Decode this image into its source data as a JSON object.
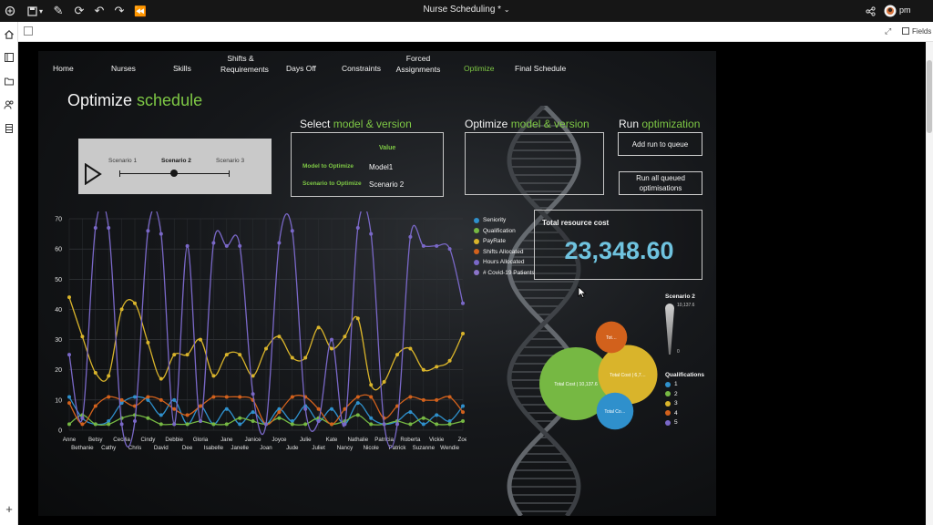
{
  "app": {
    "title": "Nurse Scheduling *",
    "user": "pm",
    "fields_label": "Fields"
  },
  "nav": {
    "items": [
      {
        "label": "Home"
      },
      {
        "label": "Nurses"
      },
      {
        "label": "Skills"
      },
      {
        "label": "Shifts & Requirements"
      },
      {
        "label": "Days Off"
      },
      {
        "label": "Constraints"
      },
      {
        "label": "Forced Assignments"
      },
      {
        "label": "Optimize"
      },
      {
        "label": "Final Schedule"
      }
    ]
  },
  "page": {
    "title_main": "Optimize",
    "title_accent": "schedule"
  },
  "scenario": {
    "labels": [
      "Scenario 1",
      "Scenario 2",
      "Scenario 3"
    ],
    "selected_index": 1
  },
  "select_model": {
    "title_main": "Select",
    "title_accent": "model & version",
    "value_header": "Value",
    "rows": [
      {
        "label": "Model to Optimize",
        "value": "Model1"
      },
      {
        "label": "Scenario to Optimize",
        "value": "Scenario 2"
      }
    ]
  },
  "optimize_model": {
    "title_main": "Optimize",
    "title_accent": "model & version"
  },
  "run": {
    "title_main": "Run",
    "title_accent": "optimization",
    "add_label": "Add run to queue",
    "run_all_label": "Run all queued optimisations"
  },
  "cost": {
    "label": "Total resource cost",
    "value": "23,348.60"
  },
  "colors": {
    "accent": "#7ec845",
    "cost": "#6fc3df",
    "seniority": "#2f90cc",
    "qualification": "#76b843",
    "payrate": "#d9b42b",
    "shifts": "#d2611c",
    "hours": "#7a68c8",
    "covid": "#8b74c9"
  },
  "chart_data": [
    {
      "type": "line",
      "categories": [
        "Anne",
        "Bethanie",
        "Betsy",
        "Cathy",
        "Cecilia",
        "Chris",
        "Cindy",
        "David",
        "Debbie",
        "Dee",
        "Gloria",
        "Isabelle",
        "Jane",
        "Janelle",
        "Janice",
        "Joan",
        "Joyce",
        "Jude",
        "Julie",
        "Juliet",
        "Kate",
        "Nancy",
        "Nathalie",
        "Nicole",
        "Patricia",
        "Patrick",
        "Roberta",
        "Suzanne",
        "Vickie",
        "Wendie",
        "Zoe"
      ],
      "ylim": [
        0,
        70
      ],
      "yticks": [
        0,
        10,
        20,
        30,
        40,
        50,
        60,
        70
      ],
      "legend_position": "right",
      "series": [
        {
          "name": "Seniority",
          "color": "#2f90cc",
          "values": [
            11,
            4,
            2,
            3,
            9,
            11,
            10,
            5,
            10,
            2,
            8,
            2,
            7,
            2,
            6,
            2,
            7,
            3,
            8,
            3,
            7,
            2,
            9,
            4,
            2,
            3,
            6,
            2,
            5,
            3,
            8
          ]
        },
        {
          "name": "Qualification",
          "color": "#76b843",
          "values": [
            2,
            5,
            2,
            2,
            4,
            5,
            4,
            2,
            2,
            2,
            3,
            2,
            2,
            4,
            3,
            2,
            4,
            2,
            2,
            4,
            2,
            3,
            5,
            2,
            2,
            3,
            2,
            4,
            2,
            2,
            3
          ]
        },
        {
          "name": "PayRate",
          "color": "#d9b42b",
          "values": [
            44,
            31,
            19,
            18,
            40,
            42,
            29,
            17,
            25,
            25,
            30,
            18,
            25,
            25,
            18,
            27,
            31,
            24,
            24,
            34,
            27,
            31,
            37,
            15,
            16,
            25,
            27,
            20,
            21,
            23,
            32
          ]
        },
        {
          "name": "Shifts Allocated",
          "color": "#d2611c",
          "values": [
            9,
            2,
            8,
            11,
            10,
            8,
            11,
            10,
            7,
            5,
            8,
            11,
            11,
            11,
            10,
            2,
            6,
            11,
            11,
            7,
            2,
            7,
            11,
            11,
            4,
            8,
            11,
            10,
            10,
            11,
            6
          ]
        },
        {
          "name": "Hours Allocated",
          "color": "#7a68c8",
          "values": [
            25,
            4,
            67,
            67,
            2,
            3,
            66,
            65,
            2,
            61,
            3,
            62,
            61,
            61,
            12,
            2,
            62,
            66,
            7,
            3,
            30,
            2,
            67,
            65,
            2,
            2,
            64,
            61,
            61,
            60,
            42
          ]
        },
        {
          "name": "# Covid-19 Patients",
          "color": "#8b74c9",
          "values": []
        }
      ]
    },
    {
      "type": "bubble",
      "bubbles": [
        {
          "label": "Total Cost | 10,137.6",
          "color": "#76b843",
          "value": 10137.6
        },
        {
          "label": "Total Cost | 6,7…",
          "color": "#d9b42b",
          "value": 6700
        },
        {
          "label": "Tot…",
          "color": "#d2611c",
          "value": 1900
        },
        {
          "label": "Total Co…",
          "color": "#2f90cc",
          "value": 2600
        }
      ],
      "size_legend": {
        "title": "Scenario 2",
        "max": "10,137.6",
        "min": "0"
      },
      "legend_title": "Qualifications",
      "legend": [
        {
          "name": "1",
          "color": "#2f90cc"
        },
        {
          "name": "2",
          "color": "#76b843"
        },
        {
          "name": "3",
          "color": "#d9b42b"
        },
        {
          "name": "4",
          "color": "#d2611c"
        },
        {
          "name": "5",
          "color": "#7a68c8"
        }
      ]
    }
  ]
}
